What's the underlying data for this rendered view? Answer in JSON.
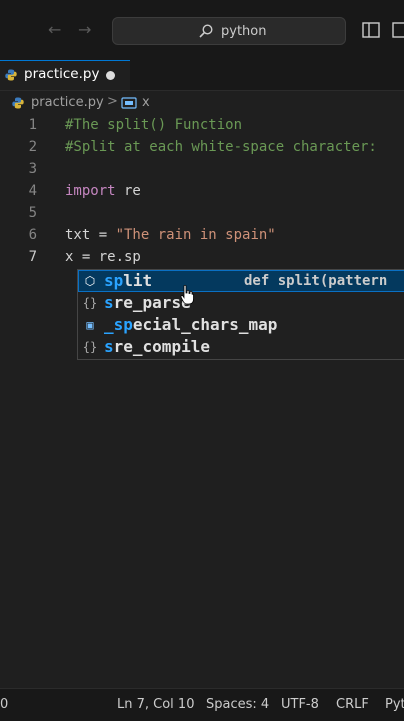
{
  "titlebar": {
    "search_text": "python"
  },
  "tab": {
    "label": "practice.py"
  },
  "breadcrumb": {
    "file": "practice.py",
    "separator": ">",
    "symbol": "x"
  },
  "editor": {
    "lines": [
      {
        "n": "1",
        "parts": [
          {
            "t": "#The split() Function",
            "c": "cmt"
          }
        ]
      },
      {
        "n": "2",
        "parts": [
          {
            "t": "#Split at each white-space character:",
            "c": "cmt"
          }
        ]
      },
      {
        "n": "3",
        "parts": []
      },
      {
        "n": "4",
        "parts": [
          {
            "t": "import",
            "c": "kw"
          },
          {
            "t": " re",
            "c": "def"
          }
        ]
      },
      {
        "n": "5",
        "parts": []
      },
      {
        "n": "6",
        "parts": [
          {
            "t": "txt = ",
            "c": "def"
          },
          {
            "t": "\"The rain in spain\"",
            "c": "str"
          }
        ]
      },
      {
        "n": "7",
        "parts": [
          {
            "t": "x = re.sp",
            "c": "def"
          }
        ]
      }
    ]
  },
  "suggest": {
    "items": [
      {
        "icon": "method-icon",
        "match": "sp",
        "rest": "lit",
        "detail": "def split(pattern"
      },
      {
        "icon": "module-braces-icon",
        "match": "s",
        "rest": "re_parse",
        "detail": ""
      },
      {
        "icon": "variable-icon",
        "match": "_sp",
        "rest": "ecial_chars_map",
        "detail": ""
      },
      {
        "icon": "module-braces-icon",
        "match": "s",
        "rest": "re_compile",
        "detail": ""
      }
    ]
  },
  "status": {
    "left": "0",
    "position": "Ln 7, Col 10",
    "spaces": "Spaces: 4",
    "encoding": "UTF-8",
    "eol": "CRLF",
    "language": "Pyt"
  },
  "colors": {
    "accent": "#0078d4",
    "comment": "#6a9955",
    "keyword": "#c586c0",
    "string": "#ce9178",
    "selection": "#04395e"
  }
}
